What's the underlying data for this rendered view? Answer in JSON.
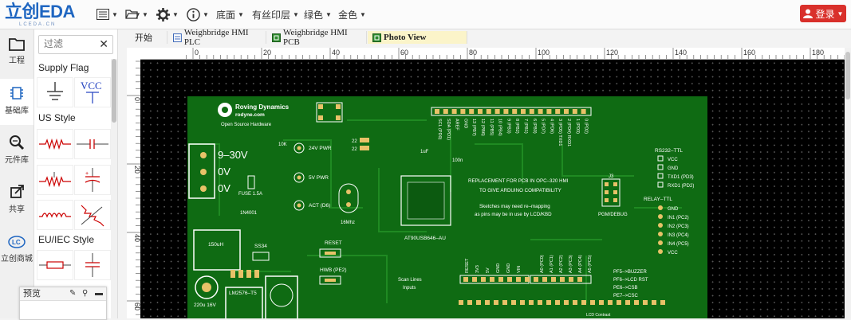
{
  "app": {
    "logo_text": "立创EDA",
    "logo_sub": "LCEDA.CN"
  },
  "toolbar": {
    "menu_bottom": "底面",
    "menu_silk": "有丝印层",
    "menu_green": "绿色",
    "menu_gold": "金色",
    "login": "登录"
  },
  "leftnav": {
    "items": [
      {
        "label": "工程",
        "icon": "folder-icon"
      },
      {
        "label": "基础库",
        "icon": "chip-icon"
      },
      {
        "label": "元件库",
        "icon": "search-icon"
      },
      {
        "label": "共享",
        "icon": "share-icon"
      },
      {
        "label": "立创商城",
        "icon": "lcsc-icon"
      }
    ]
  },
  "library": {
    "filter_placeholder": "过滤",
    "sections": {
      "supply": "Supply Flag",
      "us": "US Style",
      "eu": "EU/IEC Style"
    },
    "vcc_label": "VCC"
  },
  "preview": {
    "title": "预览"
  },
  "tabs": [
    {
      "label": "开始"
    },
    {
      "label": "Weighbridge HMI PLC"
    },
    {
      "label": "Weighbridge HMI PCB"
    },
    {
      "label": "Photo View"
    }
  ],
  "ruler": {
    "h_ticks": [
      "0",
      "20",
      "40",
      "60",
      "80",
      "100",
      "120",
      "140",
      "160",
      "180"
    ],
    "v_ticks": [
      "0",
      "20",
      "40",
      "60"
    ]
  },
  "pcb": {
    "title_line1": "Roving Dynamics",
    "title_line2": "rodyne.com",
    "title_line3": "Open Source Hardware",
    "power_9_30": "9–30V",
    "power_0v_a": "0V",
    "power_0v_b": "0V",
    "fuse": "FUSE 1.5A",
    "diode": "1N4001",
    "led_24v": "24V PWR",
    "led_5v": "5V PWR",
    "led_act": "ACT (D6)",
    "r_10k": "10K",
    "c_22a": "22",
    "c_22b": "22",
    "crystal": "16Mhz",
    "cap_1uf": "1uF",
    "cap_100n": "100n",
    "reset": "RESET",
    "hwb": "HWB (PE2)",
    "mcu": "AT90USB646–AU",
    "replace_1": "REPLACEMENT FOR PCB IN OPC–320 HMI",
    "replace_2": "TO GIVE ARDUINO COMPATIBILITY",
    "sketch_1": "Sketches may need re–mapping",
    "sketch_2": "as pins may be in use by LCD/KBD",
    "inductor": "150uH",
    "ss34": "SS34",
    "cap_220u": "220u 16V",
    "reg": "LM2576–T5",
    "pgm": "PGM/DEBUG",
    "j3": "J3",
    "rs232": "RS232–TTL",
    "rs_pins": [
      "VCC",
      "GND",
      "TXD1 (PD3)",
      "RXD1 (PD2)"
    ],
    "relay": "RELAY–TTL",
    "relay_pins": [
      "GND",
      "IN1 (PC2)",
      "IN2 (PC3)",
      "IN3 (PC4)",
      "IN4 (PC5)",
      "VCC"
    ],
    "header_pins": [
      "SCL (PD0)",
      "SDA (PD1)",
      "AREF",
      "GND",
      "13 (PB7)",
      "12 (PB6)",
      "11 (PB5)",
      "10 (PB4)",
      "9 (PB3)",
      "8 (PB2)",
      "7 (PB1)",
      "6 (PB0)",
      "5 (PD7)",
      "4 (PD6)",
      "3 (PD5) TXD1",
      "2 (PD4) RXD1",
      "1 (PD3)",
      "0 (PD2)"
    ],
    "power_pins": [
      "RESET",
      "3V3",
      "5V",
      "GND",
      "GND",
      "VIN"
    ],
    "analog_pins": [
      "A0 (PC0)",
      "A1 (PC1)",
      "A2 (PC2)",
      "A3 (PC3)",
      "A4 (PC4)",
      "A5 (PC5)"
    ],
    "scan": "Scan Lines",
    "inputs": "Inputs",
    "pf_lines": [
      "PF5–>BUZZER",
      "PF6–>LCD RST",
      "PE6–>CSB",
      "PE7–>CSC"
    ],
    "lcd_contrast": "LCD Contrast"
  },
  "colors": {
    "pcb_green": "#0f6b13",
    "login_red": "#d9302b",
    "logo_blue": "#1f66c1",
    "tab_active": "#fbf4c9"
  }
}
